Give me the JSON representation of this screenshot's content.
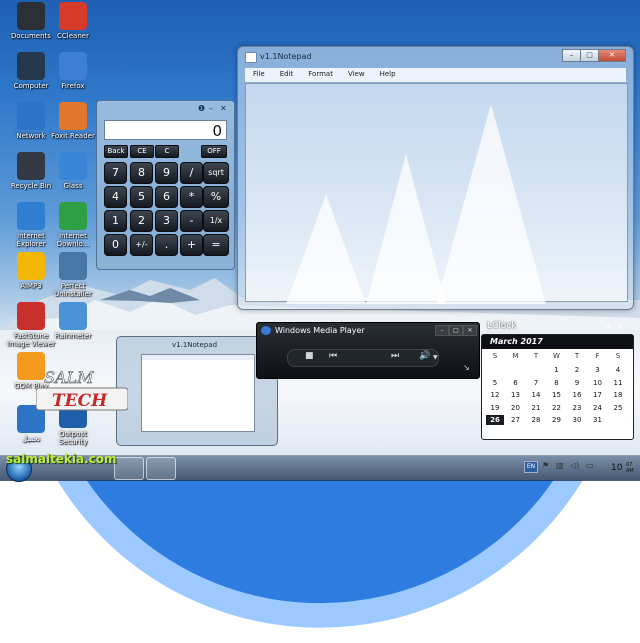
{
  "desktop_icons": [
    {
      "label": "Documents",
      "icon": "folder-icon",
      "color": "#2b2f36"
    },
    {
      "label": "CCleaner",
      "icon": "ccleaner-icon",
      "color": "#d63b2a"
    },
    {
      "label": "Computer",
      "icon": "monitor-icon",
      "color": "#26384e"
    },
    {
      "label": "Firefox",
      "icon": "firefox-icon",
      "color": "#3d7ed6"
    },
    {
      "label": "Network",
      "icon": "globe-icon",
      "color": "#2b74c7"
    },
    {
      "label": "Foxit Reader",
      "icon": "pdf-icon",
      "color": "#e2772b"
    },
    {
      "label": "Recycle Bin",
      "icon": "recycle-bin-icon",
      "color": "#333a44"
    },
    {
      "label": "Glass",
      "icon": "windows-flag-icon",
      "color": "#3a86d6"
    },
    {
      "label": "Internet Explorer",
      "icon": "ie-icon",
      "color": "#2f7fd1"
    },
    {
      "label": "Internet Downlo...",
      "icon": "download-icon",
      "color": "#2ea043"
    },
    {
      "label": "AIMP3",
      "icon": "aimp-icon",
      "color": "#f2b705"
    },
    {
      "label": "Perfect Uninstaller",
      "icon": "trash-icon",
      "color": "#4777a6"
    },
    {
      "label": "FastStone Image Viewer",
      "icon": "faststone-icon",
      "color": "#c9302c"
    },
    {
      "label": "Rainmeter",
      "icon": "raindrop-icon",
      "color": "#4a93d6"
    },
    {
      "label": "GOM Play",
      "icon": "gom-player-icon",
      "color": "#f49a1e"
    },
    {
      "label": "Outpost Security",
      "icon": "shield-icon",
      "color": "#1f5ea8"
    },
    {
      "label": "تحميل",
      "icon": "arabic-app-icon",
      "color": "#2b74c7"
    }
  ],
  "notepad": {
    "title": "v1.1Notepad",
    "menu": [
      "File",
      "Edit",
      "Format",
      "View",
      "Help"
    ]
  },
  "calculator": {
    "display": "0",
    "top_buttons": [
      "Back",
      "CE",
      "C",
      "OFF"
    ],
    "keys": [
      [
        "7",
        "8",
        "9",
        "/",
        "sqrt"
      ],
      [
        "4",
        "5",
        "6",
        "*",
        "%"
      ],
      [
        "1",
        "2",
        "3",
        "-",
        "1/x"
      ],
      [
        "0",
        "+/-",
        ".",
        "+",
        "="
      ]
    ]
  },
  "media_player": {
    "title": "Windows Media Player"
  },
  "thumbnail": {
    "title": "v1.1Notepad"
  },
  "clock": {
    "title": "LClock",
    "month": "March 2017",
    "weekdays": [
      "S",
      "M",
      "T",
      "W",
      "T",
      "F",
      "S"
    ],
    "weeks": [
      [
        "",
        "",
        "",
        "1",
        "2",
        "3",
        "4"
      ],
      [
        "5",
        "6",
        "7",
        "8",
        "9",
        "10",
        "11"
      ],
      [
        "12",
        "13",
        "14",
        "15",
        "16",
        "17",
        "18"
      ],
      [
        "19",
        "20",
        "21",
        "22",
        "23",
        "24",
        "25"
      ],
      [
        "26",
        "27",
        "28",
        "29",
        "30",
        "31",
        ""
      ]
    ],
    "today": "26"
  },
  "taskbar": {
    "lang": "EN",
    "time": "10",
    "time_suffix": "07 AM",
    "watermark": "salmaltekia.com"
  },
  "brand": {
    "line1": "SALM",
    "line2": "TECH"
  }
}
